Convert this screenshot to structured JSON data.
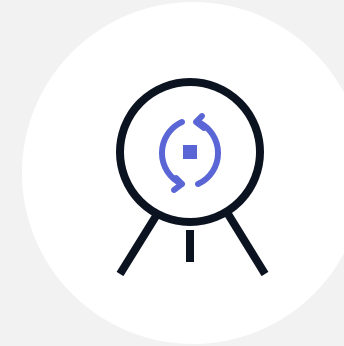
{
  "colors": {
    "page_background": "#f2f2f2",
    "badge_background": "#ffffff",
    "outline": "#0b1220",
    "accent": "#5b66d6"
  },
  "icon": {
    "name": "tripod-sync-icon",
    "parts": [
      "circle-icon",
      "sync-arrows-icon",
      "tripod-legs-icon"
    ]
  }
}
